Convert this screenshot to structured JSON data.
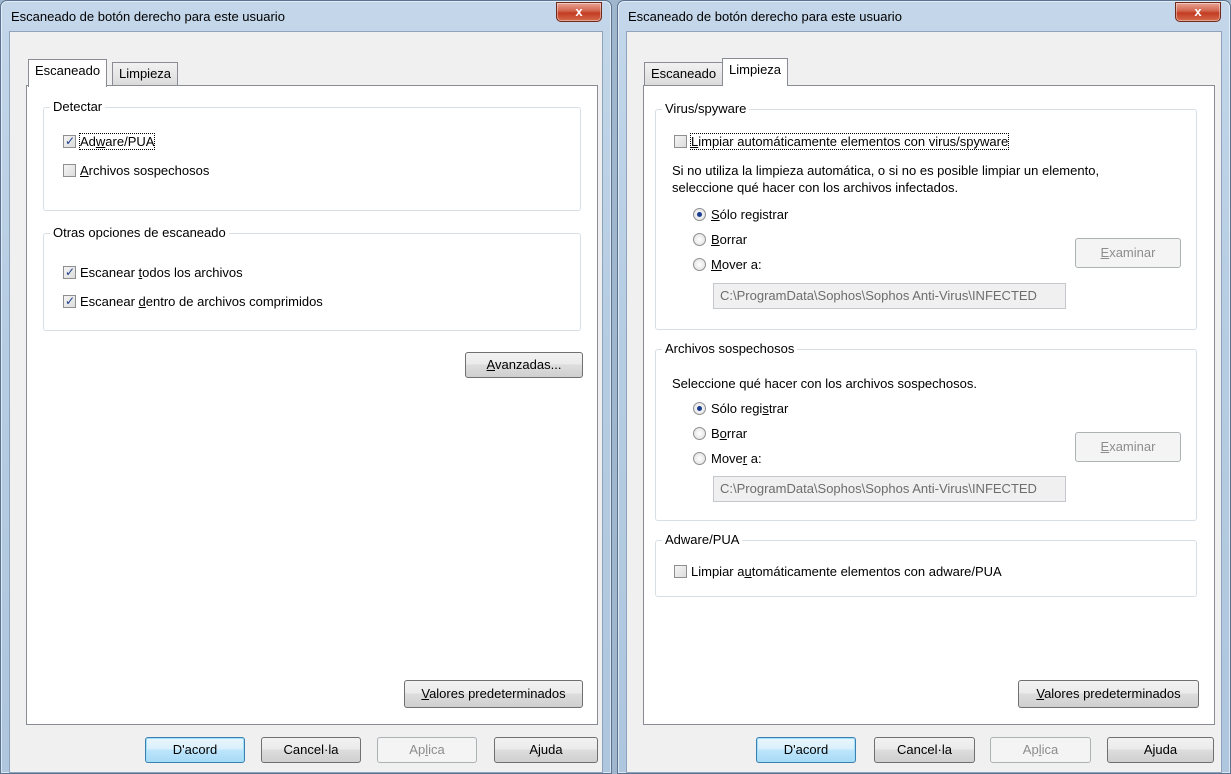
{
  "left_dialog": {
    "title": "Escaneado de botón derecho para este usuario",
    "close": "x",
    "tabs": {
      "scan": "Escaneado",
      "clean": "Limpieza"
    },
    "detect": {
      "legend": "Detectar",
      "adware": {
        "pre": "Ad",
        "u": "w",
        "post": "are/PUA",
        "checked": true
      },
      "suspicious": {
        "pre": "",
        "u": "A",
        "post": "rchivos sospechosos",
        "checked": false
      }
    },
    "other": {
      "legend": "Otras opciones de escaneado",
      "scan_all": {
        "pre": "Escanear ",
        "u": "t",
        "post": "odos los archivos",
        "checked": true
      },
      "scan_archives": {
        "pre": "Escanear ",
        "u": "d",
        "post": "entro de archivos comprimidos",
        "checked": true
      }
    },
    "advanced": {
      "u": "A",
      "post": "vanzadas..."
    },
    "defaults": {
      "u": "V",
      "post": "alores predeterminados"
    },
    "footer": {
      "ok": "D'acord",
      "cancel": "Cancel·la",
      "apply_pre": "Ap",
      "apply_u": "l",
      "apply_post": "ica",
      "help": "Ajuda"
    }
  },
  "right_dialog": {
    "title": "Escaneado de botón derecho para este usuario",
    "close": "x",
    "tabs": {
      "scan": "Escaneado",
      "clean": "Limpieza"
    },
    "virus": {
      "legend": "Virus/spyware",
      "auto_clean": {
        "u": "L",
        "post": "impiar automáticamente elementos con virus/spyware",
        "checked": false
      },
      "desc1": "Si no utiliza la limpieza automática, o si no es posible limpiar un elemento,",
      "desc2": "seleccione qué hacer con los archivos infectados.",
      "opt_log": {
        "u": "S",
        "post": "ólo registrar",
        "checked": true
      },
      "opt_delete": {
        "u": "B",
        "post": "orrar",
        "checked": false
      },
      "opt_move": {
        "u": "M",
        "post": "over a:",
        "checked": false
      },
      "path": "C:\\ProgramData\\Sophos\\Sophos Anti-Virus\\INFECTED",
      "browse": {
        "u": "E",
        "post": "xaminar"
      }
    },
    "suspicious": {
      "legend": "Archivos sospechosos",
      "desc": "Seleccione qué hacer con los archivos sospechosos.",
      "opt_log": {
        "pre": "Sólo regi",
        "u": "s",
        "post": "trar",
        "checked": true
      },
      "opt_delete": {
        "pre": "B",
        "u": "o",
        "post": "rrar",
        "checked": false
      },
      "opt_move": {
        "pre": "Move",
        "u": "r",
        "post": " a:",
        "checked": false
      },
      "path": "C:\\ProgramData\\Sophos\\Sophos Anti-Virus\\INFECTED",
      "browse": {
        "u": "E",
        "post": "xaminar"
      }
    },
    "adware": {
      "legend": "Adware/PUA",
      "auto_clean": {
        "pre": "Limpiar a",
        "u": "u",
        "post": "tomáticamente elementos con adware/PUA",
        "checked": false
      }
    },
    "defaults": {
      "u": "V",
      "post": "alores predeterminados"
    },
    "footer": {
      "ok": "D'acord",
      "cancel": "Cancel·la",
      "apply_pre": "Ap",
      "apply_u": "l",
      "apply_post": "ica",
      "help": "Ajuda"
    }
  }
}
